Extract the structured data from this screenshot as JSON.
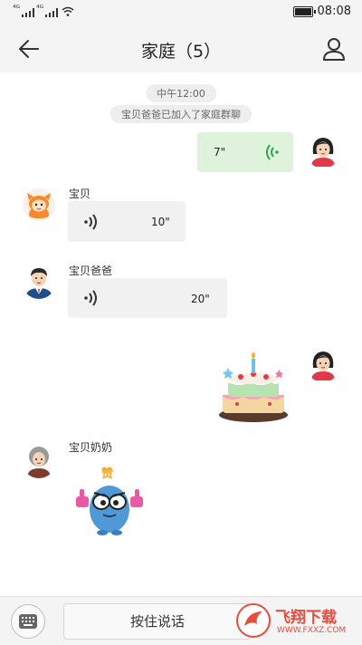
{
  "status_bar": {
    "signal1": "⁴ᴳ",
    "signal2": "⁴ᴳ",
    "time": "08:08"
  },
  "header": {
    "title": "家庭（5）",
    "back_icon": "arrow-left-icon",
    "profile_icon": "person-icon"
  },
  "chat": {
    "time_label": "中午12:00",
    "system_notice": "宝贝爸爸已加入了家庭群聊",
    "messages": [
      {
        "sender": "me",
        "type": "voice",
        "duration": "7\""
      },
      {
        "sender": "宝贝",
        "type": "voice",
        "duration": "10\""
      },
      {
        "sender": "宝贝爸爸",
        "type": "voice",
        "duration": "20\""
      },
      {
        "sender": "me",
        "type": "sticker",
        "sticker": "birthday-cake"
      },
      {
        "sender": "宝贝奶奶",
        "type": "sticker",
        "sticker": "thumbs-up-monster",
        "sticker_text": "赞"
      }
    ]
  },
  "bottom_bar": {
    "hold_to_talk": "按住说话",
    "keyboard_icon": "keyboard-icon"
  },
  "watermark": {
    "text": "飞翔下载",
    "url": "WWW.FXXZ.COM"
  },
  "colors": {
    "outgoing_bubble": "#dff3dc",
    "incoming_bubble": "#f1f1f1",
    "voice_green": "#2fa64a"
  }
}
